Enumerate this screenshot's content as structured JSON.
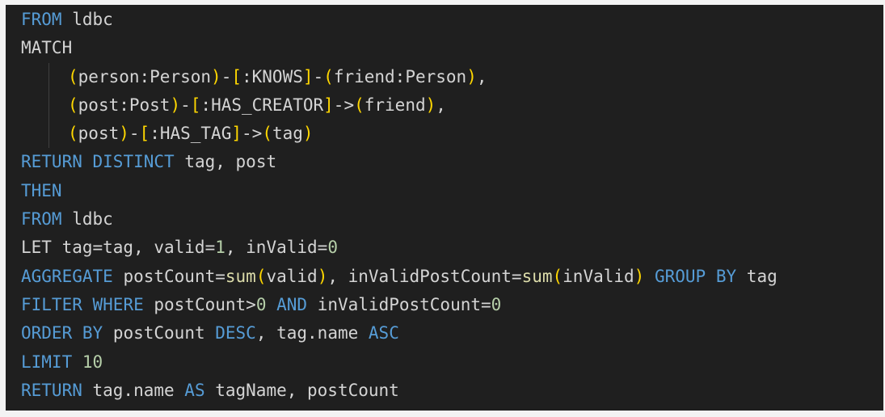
{
  "code_lines": [
    {
      "indent": false,
      "tokens": [
        {
          "t": "FROM",
          "c": "kw"
        },
        {
          "t": " ldbc",
          "c": "plain"
        }
      ]
    },
    {
      "indent": false,
      "tokens": [
        {
          "t": "MATCH",
          "c": "plain"
        }
      ]
    },
    {
      "indent": true,
      "tokens": [
        {
          "t": "(",
          "c": "br"
        },
        {
          "t": "person:Person",
          "c": "plain"
        },
        {
          "t": ")",
          "c": "br"
        },
        {
          "t": "-",
          "c": "plain"
        },
        {
          "t": "[",
          "c": "br"
        },
        {
          "t": ":KNOWS",
          "c": "plain"
        },
        {
          "t": "]",
          "c": "br"
        },
        {
          "t": "-",
          "c": "plain"
        },
        {
          "t": "(",
          "c": "br"
        },
        {
          "t": "friend:Person",
          "c": "plain"
        },
        {
          "t": ")",
          "c": "br"
        },
        {
          "t": ",",
          "c": "plain"
        }
      ]
    },
    {
      "indent": true,
      "tokens": [
        {
          "t": "(",
          "c": "br"
        },
        {
          "t": "post:Post",
          "c": "plain"
        },
        {
          "t": ")",
          "c": "br"
        },
        {
          "t": "-",
          "c": "plain"
        },
        {
          "t": "[",
          "c": "br"
        },
        {
          "t": ":HAS_CREATOR",
          "c": "plain"
        },
        {
          "t": "]",
          "c": "br"
        },
        {
          "t": "->",
          "c": "plain"
        },
        {
          "t": "(",
          "c": "br"
        },
        {
          "t": "friend",
          "c": "plain"
        },
        {
          "t": ")",
          "c": "br"
        },
        {
          "t": ",",
          "c": "plain"
        }
      ]
    },
    {
      "indent": true,
      "tokens": [
        {
          "t": "(",
          "c": "br"
        },
        {
          "t": "post",
          "c": "plain"
        },
        {
          "t": ")",
          "c": "br"
        },
        {
          "t": "-",
          "c": "plain"
        },
        {
          "t": "[",
          "c": "br"
        },
        {
          "t": ":HAS_TAG",
          "c": "plain"
        },
        {
          "t": "]",
          "c": "br"
        },
        {
          "t": "->",
          "c": "plain"
        },
        {
          "t": "(",
          "c": "br"
        },
        {
          "t": "tag",
          "c": "plain"
        },
        {
          "t": ")",
          "c": "br"
        }
      ]
    },
    {
      "indent": false,
      "tokens": [
        {
          "t": "RETURN",
          "c": "kw"
        },
        {
          "t": " ",
          "c": "plain"
        },
        {
          "t": "DISTINCT",
          "c": "kw"
        },
        {
          "t": " tag, post",
          "c": "plain"
        }
      ]
    },
    {
      "indent": false,
      "tokens": [
        {
          "t": "THEN",
          "c": "kw"
        }
      ]
    },
    {
      "indent": false,
      "tokens": [
        {
          "t": "FROM",
          "c": "kw"
        },
        {
          "t": " ldbc",
          "c": "plain"
        }
      ]
    },
    {
      "indent": false,
      "tokens": [
        {
          "t": "LET tag=tag, valid=",
          "c": "plain"
        },
        {
          "t": "1",
          "c": "num"
        },
        {
          "t": ", inValid=",
          "c": "plain"
        },
        {
          "t": "0",
          "c": "num"
        }
      ]
    },
    {
      "indent": false,
      "tokens": [
        {
          "t": "AGGREGATE",
          "c": "kw"
        },
        {
          "t": " postCount=",
          "c": "plain"
        },
        {
          "t": "sum",
          "c": "fn"
        },
        {
          "t": "(",
          "c": "br"
        },
        {
          "t": "valid",
          "c": "plain"
        },
        {
          "t": ")",
          "c": "br"
        },
        {
          "t": ", inValidPostCount=",
          "c": "plain"
        },
        {
          "t": "sum",
          "c": "fn"
        },
        {
          "t": "(",
          "c": "br"
        },
        {
          "t": "inValid",
          "c": "plain"
        },
        {
          "t": ")",
          "c": "br"
        },
        {
          "t": " ",
          "c": "plain"
        },
        {
          "t": "GROUP",
          "c": "kw"
        },
        {
          "t": " ",
          "c": "plain"
        },
        {
          "t": "BY",
          "c": "kw"
        },
        {
          "t": " tag",
          "c": "plain"
        }
      ]
    },
    {
      "indent": false,
      "tokens": [
        {
          "t": "FILTER",
          "c": "kw"
        },
        {
          "t": " ",
          "c": "plain"
        },
        {
          "t": "WHERE",
          "c": "kw"
        },
        {
          "t": " postCount>",
          "c": "plain"
        },
        {
          "t": "0",
          "c": "num"
        },
        {
          "t": " ",
          "c": "plain"
        },
        {
          "t": "AND",
          "c": "kw"
        },
        {
          "t": " inValidPostCount=",
          "c": "plain"
        },
        {
          "t": "0",
          "c": "num"
        }
      ]
    },
    {
      "indent": false,
      "tokens": [
        {
          "t": "ORDER",
          "c": "kw"
        },
        {
          "t": " ",
          "c": "plain"
        },
        {
          "t": "BY",
          "c": "kw"
        },
        {
          "t": " postCount ",
          "c": "plain"
        },
        {
          "t": "DESC",
          "c": "kw"
        },
        {
          "t": ", tag.name ",
          "c": "plain"
        },
        {
          "t": "ASC",
          "c": "kw"
        }
      ]
    },
    {
      "indent": false,
      "tokens": [
        {
          "t": "LIMIT",
          "c": "kw"
        },
        {
          "t": " ",
          "c": "plain"
        },
        {
          "t": "10",
          "c": "num"
        }
      ]
    },
    {
      "indent": false,
      "tokens": [
        {
          "t": "RETURN",
          "c": "kw"
        },
        {
          "t": " tag.name ",
          "c": "plain"
        },
        {
          "t": "AS",
          "c": "kw"
        },
        {
          "t": " tagName, postCount",
          "c": "plain"
        }
      ]
    }
  ],
  "theme": {
    "background": "#1f1f1f",
    "keyword": "#569cd6",
    "text": "#d4d4d4",
    "function": "#dcdcaa",
    "number": "#b5cea8",
    "bracket": "#ffd700"
  }
}
